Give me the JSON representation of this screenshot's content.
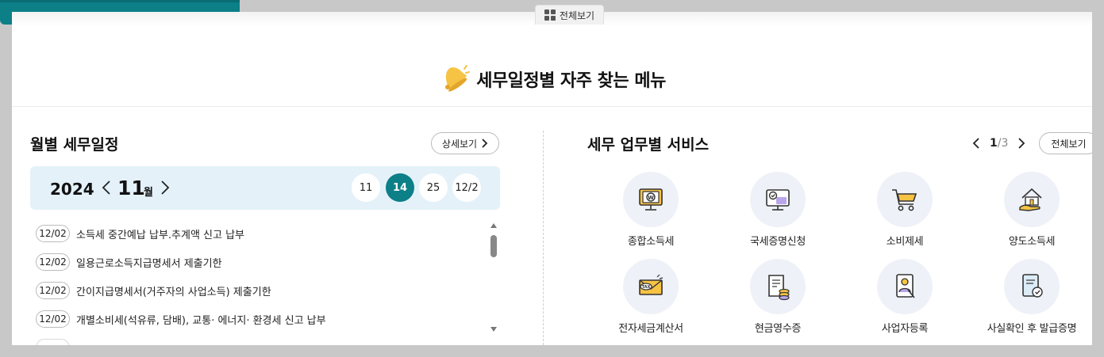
{
  "top_tab": {
    "label": "전체보기"
  },
  "main_title": "세무일정별 자주 찾는 메뉴",
  "schedule": {
    "title": "월별 세무일정",
    "detail_label": "상세보기",
    "year": "2024",
    "month": "11",
    "month_unit": "월",
    "days": [
      "11",
      "14",
      "25",
      "12/2"
    ],
    "active_day": "14",
    "items": [
      {
        "date": "12/02",
        "text": "소득세 중간예납 납부.추계액 신고 납부"
      },
      {
        "date": "12/02",
        "text": "일용근로소득지급명세서 제출기한"
      },
      {
        "date": "12/02",
        "text": "간이지급명세서(거주자의 사업소득) 제출기한"
      },
      {
        "date": "12/02",
        "text": "개별소비세(석유류, 담배), 교통· 에너지· 환경세 신고 납부"
      }
    ]
  },
  "services": {
    "title": "세무 업무별 서비스",
    "page_current": "1",
    "page_sep": "/",
    "page_total": "3",
    "all_label": "전체보기",
    "items": [
      {
        "label": "종합소득세",
        "icon": "monitor-won-icon"
      },
      {
        "label": "국세증명신청",
        "icon": "certificate-monitor-icon"
      },
      {
        "label": "소비제세",
        "icon": "shopping-cart-icon"
      },
      {
        "label": "양도소득세",
        "icon": "house-hand-icon"
      },
      {
        "label": "전자세금계산서",
        "icon": "tax-envelope-icon"
      },
      {
        "label": "현금영수증",
        "icon": "receipt-coins-icon"
      },
      {
        "label": "사업자등록",
        "icon": "business-person-icon"
      },
      {
        "label": "사실확인 후 발급증명",
        "icon": "verified-document-icon"
      }
    ]
  },
  "colors": {
    "accent": "#0c7f87",
    "month_bar": "#e4f1f9",
    "icon_bg": "#eef1f7",
    "yellow": "#f6c344",
    "purple": "#b8a6ea"
  }
}
